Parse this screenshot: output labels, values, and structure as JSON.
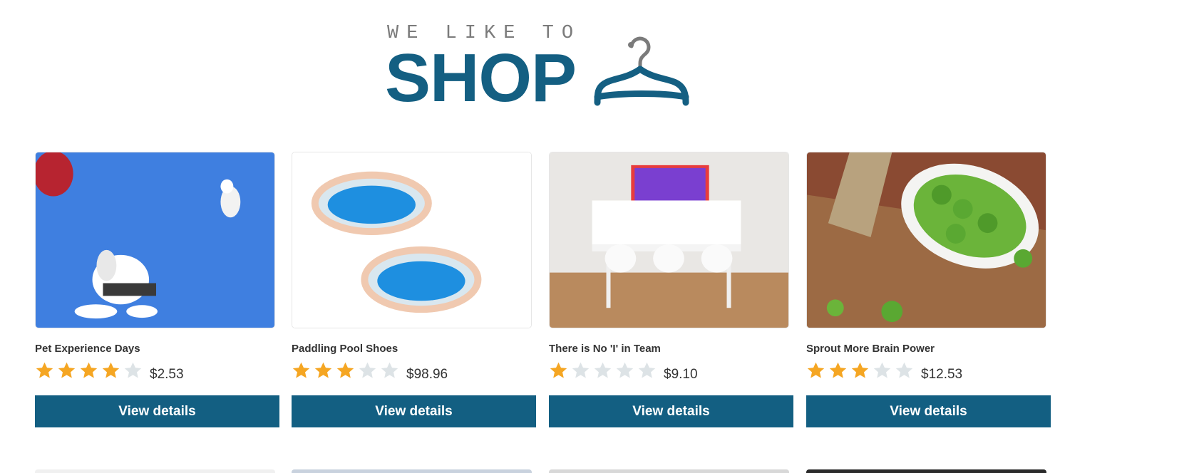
{
  "logo": {
    "tagline": "WE LIKE TO",
    "wordmark": "SHOP",
    "icon": "hanger-icon",
    "brand_color": "#145f82",
    "tagline_color": "#7b7b7b"
  },
  "rating_colors": {
    "filled": "#f5a623",
    "empty": "#dde3e6"
  },
  "products": [
    {
      "name": "Pet Experience Days",
      "rating": 4,
      "rating_max": 5,
      "price": "$2.53",
      "button_label": "View details",
      "image": "dogs-with-balloons"
    },
    {
      "name": "Paddling Pool Shoes",
      "rating": 3,
      "rating_max": 5,
      "price": "$98.96",
      "button_label": "View details",
      "image": "inflatable-pools"
    },
    {
      "name": "There is No 'I' in Team",
      "rating": 1,
      "rating_max": 5,
      "price": "$9.10",
      "button_label": "View details",
      "image": "team-meeting-room"
    },
    {
      "name": "Sprout More Brain Power",
      "rating": 3,
      "rating_max": 5,
      "price": "$12.53",
      "button_label": "View details",
      "image": "brussels-sprouts-bowl"
    }
  ]
}
